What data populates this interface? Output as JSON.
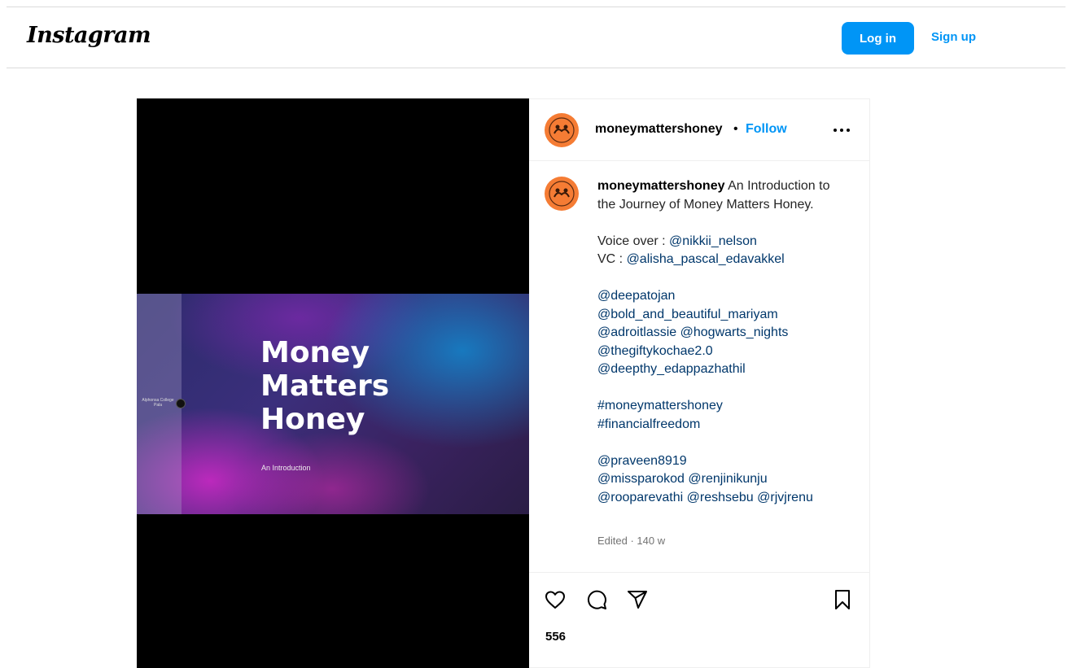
{
  "header": {
    "logo": "Instagram",
    "login_label": "Log in",
    "signup_label": "Sign up",
    "login_color": "#0095f6"
  },
  "post": {
    "slide": {
      "college": "Alphonsa College Pala",
      "title_lines": [
        "Money",
        "Matters",
        "Honey"
      ],
      "subtitle": "An Introduction"
    },
    "author": {
      "username": "moneymattershoney",
      "separator": "•",
      "follow_label": "Follow",
      "more_icon": "more-horizontal-icon"
    },
    "caption": {
      "username": "moneymattershoney",
      "intro": " An Introduction to the Journey of Money Matters Honey.",
      "voice_over_label": "Voice over : ",
      "voice_over_mention": "@nikkii_nelson",
      "vc_label": "VC : ",
      "vc_mention": "@alisha_pascal_edavakkel",
      "mentions_1": [
        "@deepatojan",
        "@bold_and_beautiful_mariyam",
        "@adroitlassie",
        "@hogwarts_nights",
        "@thegiftykochae2.0",
        "@deepthy_edappazhathil"
      ],
      "hashtags": [
        "#moneymattershoney",
        "#financialfreedom"
      ],
      "mentions_2": [
        "@praveen8919",
        "@missparokod",
        "@renjinikunju",
        "@rooparevathi",
        "@reshsebu",
        "@rjvjrenu"
      ],
      "edited": "Edited · 140 w"
    },
    "actions": {
      "icons": [
        "heart-icon",
        "comment-icon",
        "share-icon",
        "bookmark-icon"
      ]
    },
    "likes_partial": "556 "
  }
}
